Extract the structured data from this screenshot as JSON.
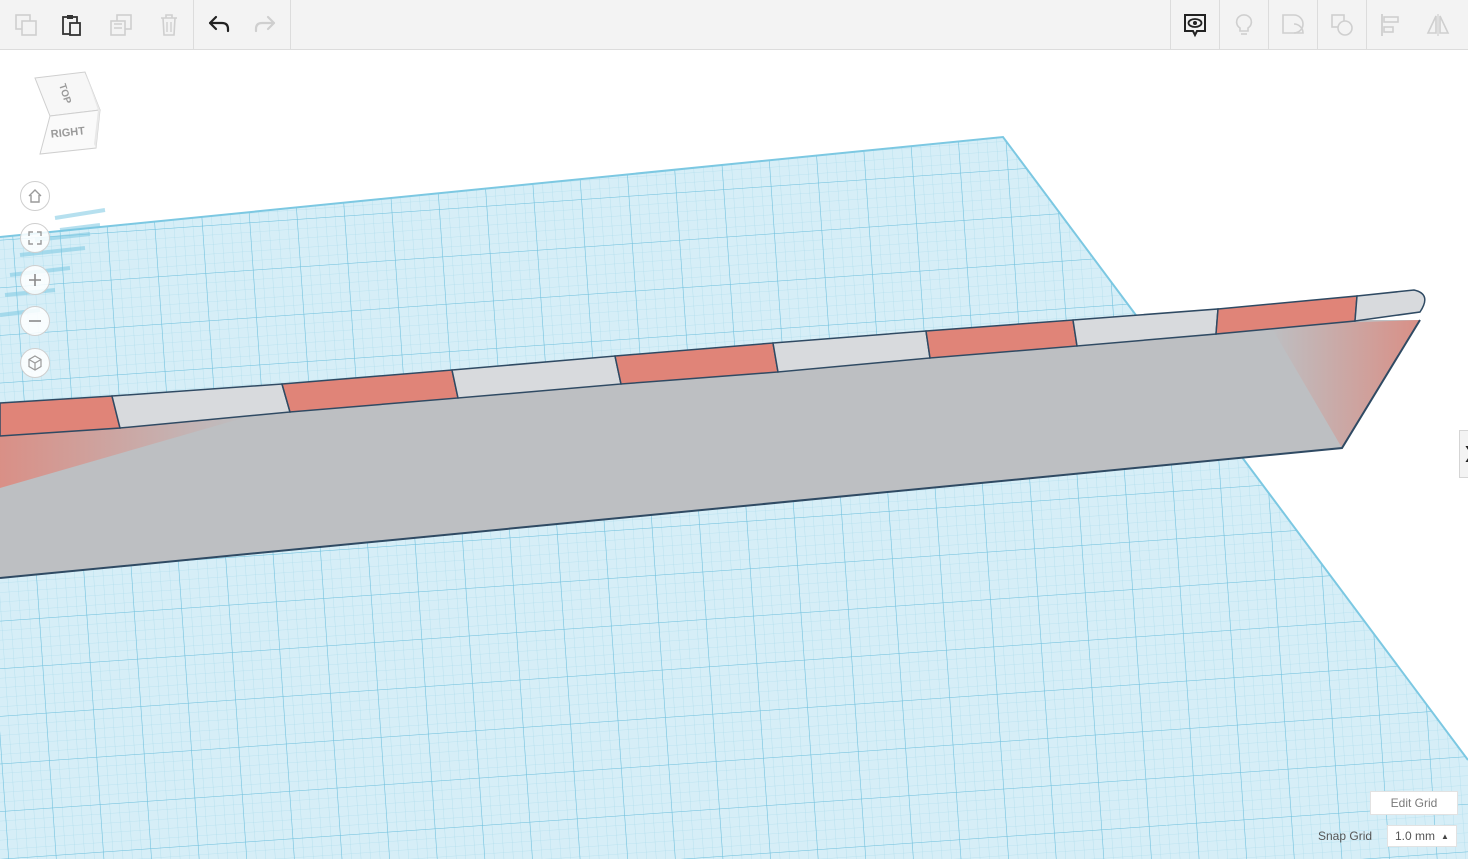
{
  "toolbar": {
    "left_buttons": [
      {
        "name": "copy",
        "icon": "copy-icon",
        "enabled": false
      },
      {
        "name": "paste",
        "icon": "paste-icon",
        "enabled": true
      },
      {
        "name": "duplicate",
        "icon": "duplicate-icon",
        "enabled": false
      },
      {
        "name": "delete",
        "icon": "trash-icon",
        "enabled": false
      },
      {
        "name": "undo",
        "icon": "undo-icon",
        "enabled": true
      },
      {
        "name": "redo",
        "icon": "redo-icon",
        "enabled": false
      }
    ],
    "right_buttons": [
      {
        "name": "notes",
        "icon": "eye-note-icon",
        "enabled": true
      },
      {
        "name": "show-all",
        "icon": "lightbulb-icon",
        "enabled": false
      },
      {
        "name": "group",
        "icon": "group-icon",
        "enabled": false
      },
      {
        "name": "ungroup",
        "icon": "ungroup-icon",
        "enabled": false
      },
      {
        "name": "align",
        "icon": "align-icon",
        "enabled": false
      },
      {
        "name": "mirror",
        "icon": "mirror-icon",
        "enabled": false
      }
    ]
  },
  "viewcube": {
    "top_label": "TOP",
    "front_label": "RIGHT"
  },
  "nav_controls": [
    {
      "name": "home-view",
      "icon": "home-icon"
    },
    {
      "name": "fit-view",
      "icon": "fit-icon"
    },
    {
      "name": "zoom-in",
      "icon": "plus-icon"
    },
    {
      "name": "zoom-out",
      "icon": "minus-icon"
    },
    {
      "name": "perspective-toggle",
      "icon": "cube-icon"
    }
  ],
  "grid": {
    "edit_label": "Edit Grid",
    "snap_label": "Snap Grid",
    "snap_value": "1.0 mm"
  },
  "colors": {
    "workplane": "#cfeaf4",
    "grid_minor": "#a6d9ea",
    "grid_major": "#6fc0dd",
    "shape_gray": "#bdbfc2",
    "shape_red": "#e08478",
    "outline": "#2f4a63"
  }
}
